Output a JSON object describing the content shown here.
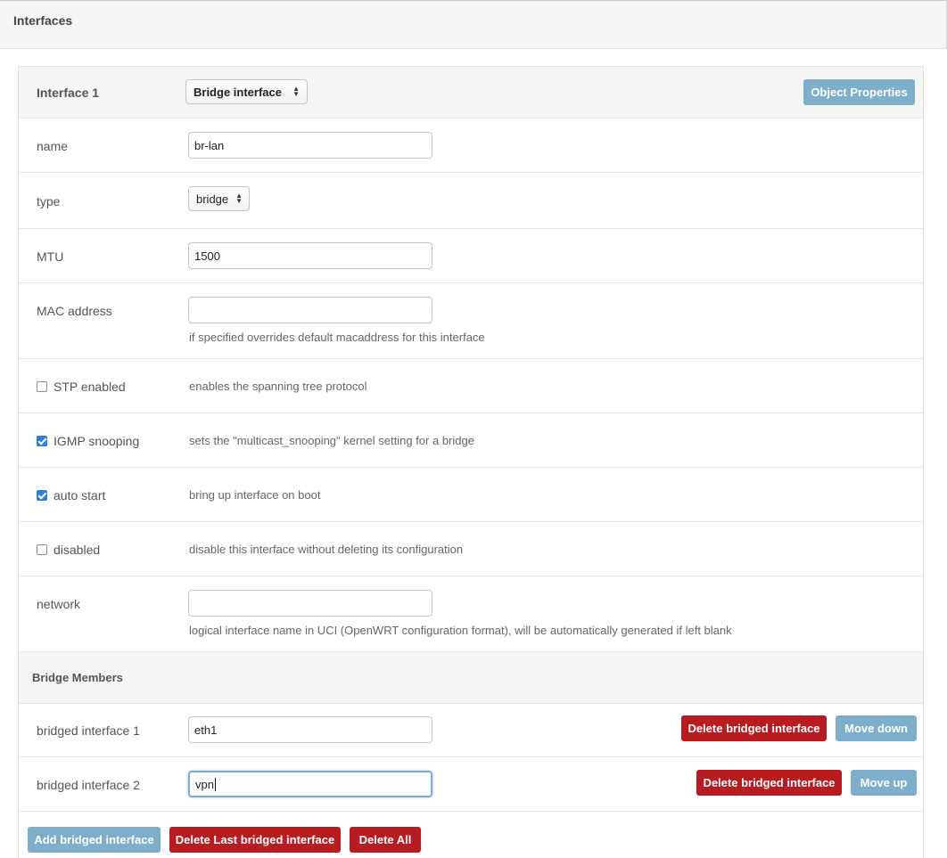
{
  "header": {
    "title": "Interfaces"
  },
  "interface": {
    "title": "Interface 1",
    "kind_select": "Bridge interface",
    "object_properties_label": "Object Properties"
  },
  "fields": {
    "name": {
      "label": "name",
      "value": "br-lan"
    },
    "type": {
      "label": "type",
      "value": "bridge"
    },
    "mtu": {
      "label": "MTU",
      "value": "1500"
    },
    "mac": {
      "label": "MAC address",
      "value": "",
      "help": "if specified overrides default macaddress for this interface"
    },
    "stp": {
      "label": "STP enabled",
      "checked": false,
      "help": "enables the spanning tree protocol"
    },
    "igmp": {
      "label": "IGMP snooping",
      "checked": true,
      "help": "sets the \"multicast_snooping\" kernel setting for a bridge"
    },
    "autostart": {
      "label": "auto start",
      "checked": true,
      "help": "bring up interface on boot"
    },
    "disabled": {
      "label": "disabled",
      "checked": false,
      "help": "disable this interface without deleting its configuration"
    },
    "network": {
      "label": "network",
      "value": "",
      "help": "logical interface name in UCI (OpenWRT configuration format), will be automatically generated if left blank"
    }
  },
  "bridge_members": {
    "title": "Bridge Members",
    "items": [
      {
        "label": "bridged interface 1",
        "value": "eth1",
        "delete_label": "Delete bridged interface",
        "move_label": "Move down"
      },
      {
        "label": "bridged interface 2",
        "value": "vpn",
        "delete_label": "Delete bridged interface",
        "move_label": "Move up"
      }
    ]
  },
  "footer": {
    "add_label": "Add bridged interface",
    "delete_last_label": "Delete Last bridged interface",
    "delete_all_label": "Delete All"
  },
  "colors": {
    "primary_blue": "#7eaec9",
    "danger_red": "#b71c21",
    "checkbox_blue": "#2f7ddc",
    "focus_border": "#7aaedf"
  }
}
